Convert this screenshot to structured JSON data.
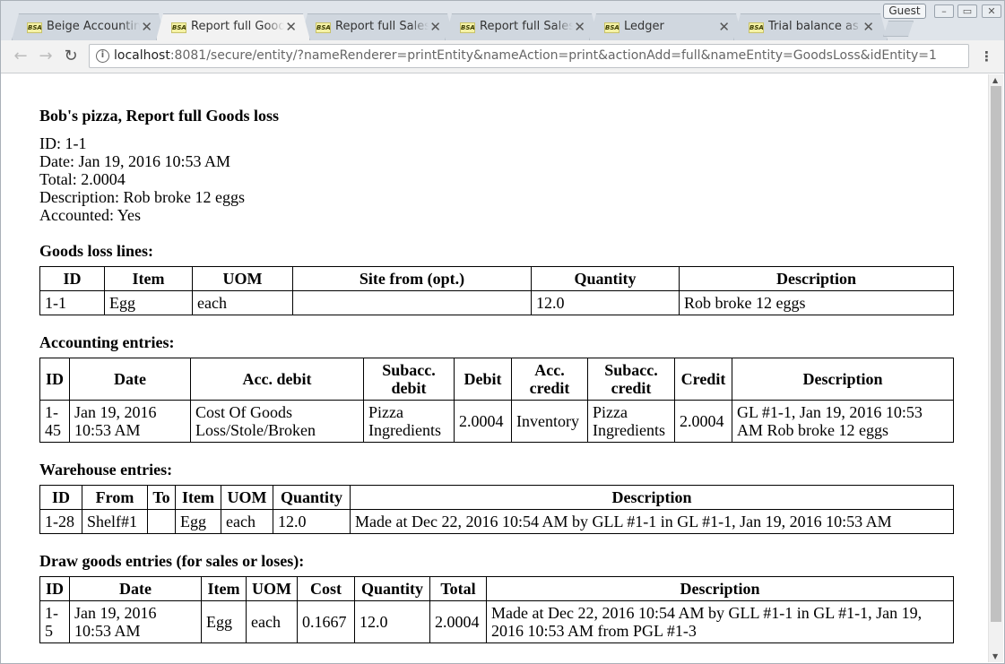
{
  "browser": {
    "tabs": [
      {
        "title": "Beige Accounting",
        "active": false
      },
      {
        "title": "Report full Goods loss",
        "active": true
      },
      {
        "title": "Report full Sales",
        "active": false
      },
      {
        "title": "Report full Sales",
        "active": false
      },
      {
        "title": "Ledger",
        "active": false
      },
      {
        "title": "Trial balance as",
        "active": false
      }
    ],
    "favicon_text": "BSA",
    "profile": "Guest",
    "url_host": "localhost",
    "url_rest": ":8081/secure/entity/?nameRenderer=printEntity&nameAction=print&actionAdd=full&nameEntity=GoodsLoss&idEntity=1",
    "colors": {
      "tabstrip": "#dfe4ea",
      "active_tab": "#f2f2f2",
      "toolbar": "#f2f2f2"
    }
  },
  "report": {
    "title": "Bob's pizza, Report full Goods loss",
    "fields": [
      "ID: 1-1",
      "Date: Jan 19, 2016 10:53 AM",
      "Total: 2.0004",
      "Description: Rob broke 12 eggs",
      "Accounted: Yes"
    ],
    "goods_loss": {
      "heading": "Goods loss lines:",
      "headers": [
        "ID",
        "Item",
        "UOM",
        "Site from (opt.)",
        "Quantity",
        "Description"
      ],
      "rows": [
        [
          "1-1",
          "Egg",
          "each",
          "",
          "12.0",
          "Rob broke 12 eggs"
        ]
      ]
    },
    "accounting": {
      "heading": "Accounting entries:",
      "headers": [
        "ID",
        "Date",
        "Acc. debit",
        "Subacc. debit",
        "Debit",
        "Acc. credit",
        "Subacc. credit",
        "Credit",
        "Description"
      ],
      "rows": [
        [
          "1-45",
          "Jan 19, 2016 10:53 AM",
          "Cost Of Goods Loss/Stole/Broken",
          "Pizza Ingredients",
          "2.0004",
          "Inventory",
          "Pizza Ingredients",
          "2.0004",
          "GL #1-1, Jan 19, 2016 10:53 AM Rob broke 12 eggs"
        ]
      ]
    },
    "warehouse": {
      "heading": "Warehouse entries:",
      "headers": [
        "ID",
        "From",
        "To",
        "Item",
        "UOM",
        "Quantity",
        "Description"
      ],
      "rows": [
        [
          "1-28",
          "Shelf#1",
          "",
          "Egg",
          "each",
          "12.0",
          "Made at Dec 22, 2016 10:54 AM by GLL #1-1 in GL #1-1, Jan 19, 2016 10:53 AM"
        ]
      ]
    },
    "draw": {
      "heading": "Draw goods entries (for sales or loses):",
      "headers": [
        "ID",
        "Date",
        "Item",
        "UOM",
        "Cost",
        "Quantity",
        "Total",
        "Description"
      ],
      "rows": [
        [
          "1-5",
          "Jan 19, 2016 10:53 AM",
          "Egg",
          "each",
          "0.1667",
          "12.0",
          "2.0004",
          "Made at Dec 22, 2016 10:54 AM by GLL #1-1 in GL #1-1, Jan 19, 2016 10:53 AM from PGL #1-3"
        ]
      ]
    }
  }
}
